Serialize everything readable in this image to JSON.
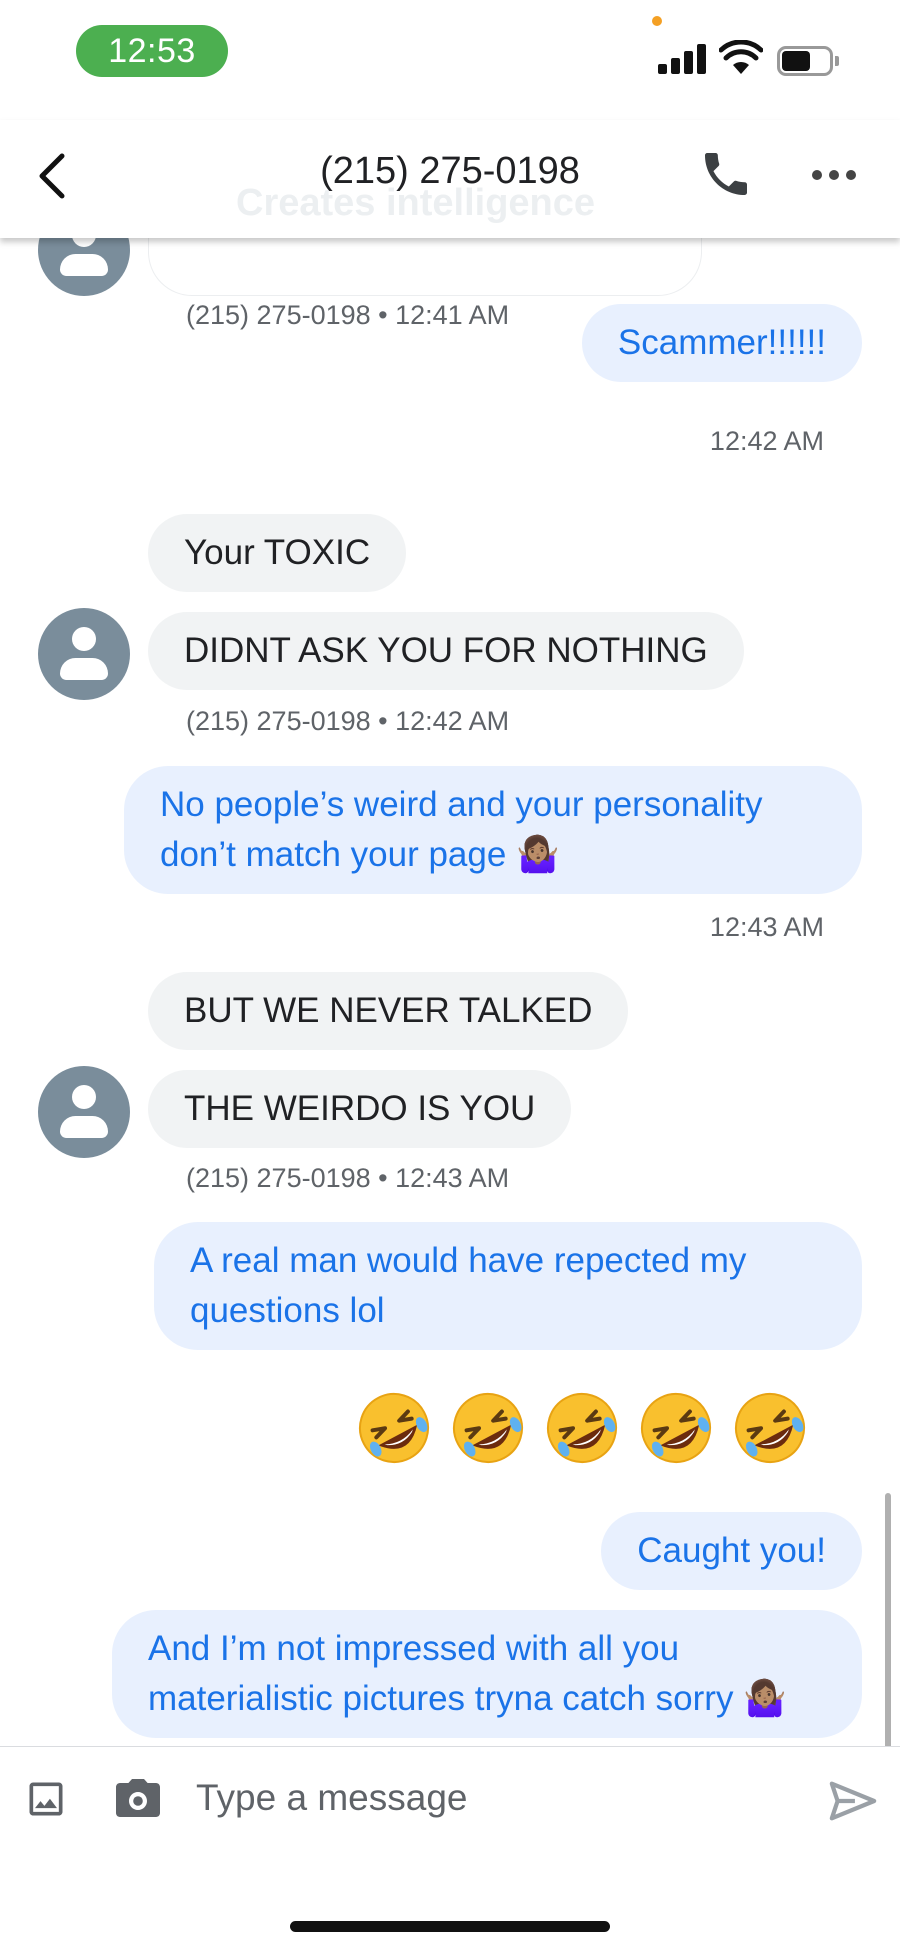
{
  "status_bar": {
    "time": "12:53"
  },
  "header": {
    "title": "(215) 275-0198",
    "ghost_text": "Creates intelligence",
    "back_icon": "chevron-left-icon",
    "call_icon": "phone-icon",
    "more_icon": "more-horizontal-icon"
  },
  "messages": [
    {
      "dir": "in",
      "text": "",
      "meta": "(215) 275-0198 • 12:41 AM"
    },
    {
      "dir": "out",
      "text": "Scammer!!!!!!",
      "meta": "12:42 AM"
    },
    {
      "dir": "in",
      "text": "Your TOXIC"
    },
    {
      "dir": "in",
      "text": "DIDNT ASK YOU FOR NOTHING",
      "meta": "(215) 275-0198 • 12:42 AM"
    },
    {
      "dir": "out",
      "text": "No people’s weird and your personality don’t match your page 🤷🏽‍♀️",
      "meta": "12:43 AM"
    },
    {
      "dir": "in",
      "text": "BUT WE NEVER TALKED"
    },
    {
      "dir": "in",
      "text": "THE WEIRDO IS YOU",
      "meta": "(215) 275-0198 • 12:43 AM"
    },
    {
      "dir": "out",
      "text": "A real man would have repected my questions lol"
    },
    {
      "dir": "out",
      "text": "🤣🤣🤣🤣🤣"
    },
    {
      "dir": "out",
      "text": "Caught you!"
    },
    {
      "dir": "out",
      "text": "And I’m not impressed with all you materialistic pictures tryna catch sorry 🤷🏽‍♀️"
    }
  ],
  "composer": {
    "placeholder": "Type a message",
    "gallery_icon": "image-icon",
    "camera_icon": "camera-icon",
    "send_icon": "send-icon"
  },
  "colors": {
    "incoming_bubble": "#f1f3f4",
    "outgoing_bubble": "#e8f0fe",
    "outgoing_text": "#1a73e8",
    "avatar": "#7a8d9b",
    "time_pill": "#4caf50"
  }
}
